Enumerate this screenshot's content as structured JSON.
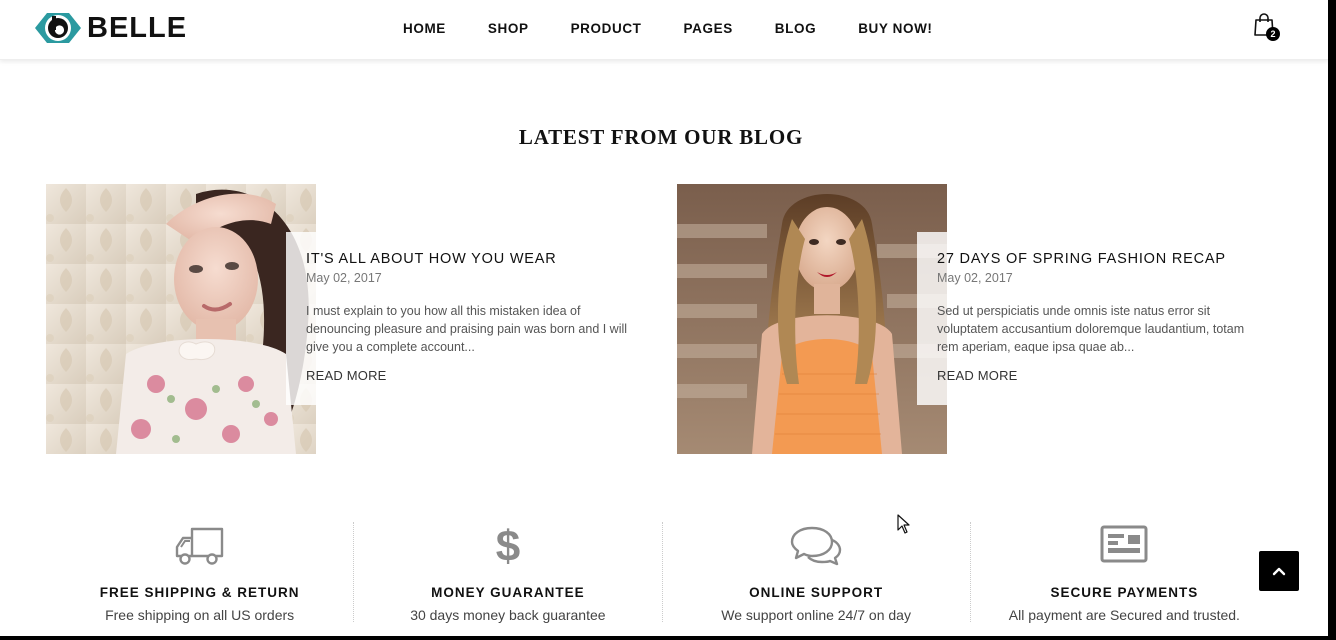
{
  "brand": {
    "name": "BELLE",
    "accent": "#2b9aa0"
  },
  "nav": {
    "items": [
      {
        "label": "HOME"
      },
      {
        "label": "SHOP"
      },
      {
        "label": "PRODUCT"
      },
      {
        "label": "PAGES"
      },
      {
        "label": "BLOG"
      },
      {
        "label": "BUY NOW!"
      }
    ]
  },
  "cart": {
    "icon": "shopping-bag-icon",
    "count": "2"
  },
  "blog": {
    "title": "LATEST FROM OUR BLOG",
    "posts": [
      {
        "title": "IT'S ALL ABOUT HOW YOU WEAR",
        "date": "May 02, 2017",
        "excerpt": "I must explain to you how all this mistaken idea of denouncing pleasure and praising pain was born and I will give you a complete account...",
        "read_more": "READ MORE"
      },
      {
        "title": "27 DAYS OF SPRING FASHION RECAP",
        "date": "May 02, 2017",
        "excerpt": "Sed ut perspiciatis unde omnis iste natus error sit voluptatem accusantium doloremque laudantium, totam rem aperiam, eaque ipsa quae ab...",
        "read_more": "READ MORE"
      }
    ]
  },
  "features": [
    {
      "icon": "truck-icon",
      "title": "FREE SHIPPING & RETURN",
      "desc": "Free shipping on all US orders"
    },
    {
      "icon": "dollar-icon",
      "title": "MONEY GUARANTEE",
      "desc": "30 days money back guarantee"
    },
    {
      "icon": "chat-bubbles-icon",
      "title": "ONLINE SUPPORT",
      "desc": "We support online 24/7 on day"
    },
    {
      "icon": "credit-card-icon",
      "title": "SECURE PAYMENTS",
      "desc": "All payment are Secured and trusted."
    }
  ],
  "back_to_top": {
    "icon": "chevron-up-icon"
  }
}
